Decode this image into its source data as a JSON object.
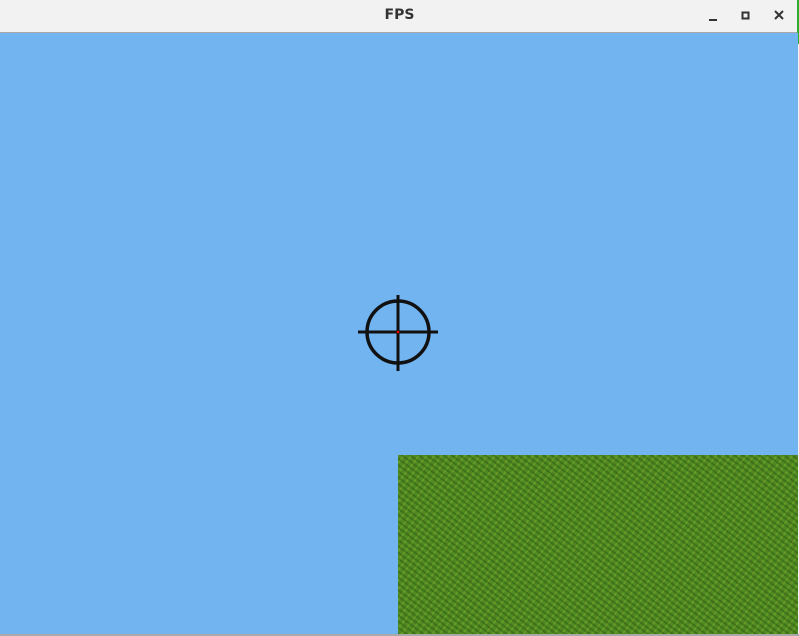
{
  "window": {
    "title": "FPS",
    "controls": [
      "minimize",
      "maximize",
      "close"
    ]
  },
  "scene": {
    "sky_color": "#71b4ef",
    "ground_texture": "grass",
    "crosshair_center_color": "#ff0000"
  }
}
